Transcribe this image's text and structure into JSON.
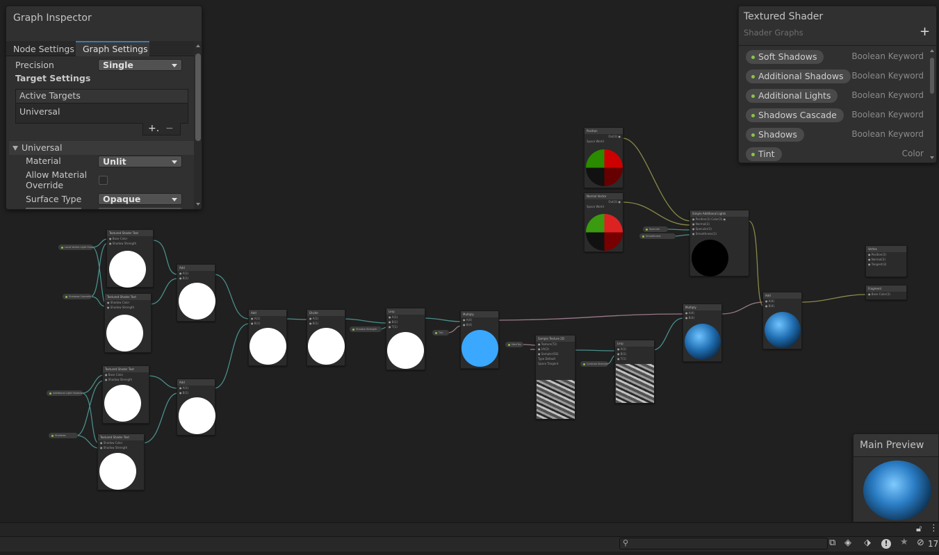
{
  "inspector": {
    "title": "Graph Inspector",
    "tabs": [
      "Node Settings",
      "Graph Settings"
    ],
    "active_tab": "Graph Settings",
    "precision_label": "Precision",
    "precision_value": "Single",
    "target_settings_label": "Target Settings",
    "active_targets_label": "Active Targets",
    "target_item": "Universal",
    "add_symbol": "+.",
    "remove_symbol": "−",
    "section_label": "Universal",
    "material_label": "Material",
    "material_value": "Unlit",
    "allow_override_label": "Allow Material Override",
    "surface_type_label": "Surface Type",
    "surface_type_value": "Opaque"
  },
  "blackboard": {
    "title": "Textured Shader",
    "subtitle": "Shader Graphs",
    "add_symbol": "+",
    "properties": [
      {
        "name": "Soft Shadows",
        "type": "Boolean Keyword"
      },
      {
        "name": "Additional Shadows",
        "type": "Boolean Keyword"
      },
      {
        "name": "Additional Lights",
        "type": "Boolean Keyword"
      },
      {
        "name": "Shadows Cascade",
        "type": "Boolean Keyword"
      },
      {
        "name": "Shadows",
        "type": "Boolean Keyword"
      },
      {
        "name": "Tint",
        "type": "Color"
      }
    ]
  },
  "main_preview": {
    "title": "Main Preview"
  },
  "statusbar": {
    "badge_count": "17",
    "search_placeholder": ""
  },
  "colors": {
    "accent_blue": "#3aa8ff",
    "keyword_dot": "#8bc34a",
    "wire_teal": "#4a8f8a",
    "wire_olive": "#8a8a4a",
    "wire_pink": "#9a7a8a"
  },
  "nodes": [
    {
      "title": "Textured Shader Text",
      "preview": "white"
    },
    {
      "title": "Textured Shader Text",
      "preview": "white"
    },
    {
      "title": "Add",
      "preview": "white"
    },
    {
      "title": "Textured Shader Text",
      "preview": "white"
    },
    {
      "title": "Textured Shader Text",
      "preview": "white"
    },
    {
      "title": "Add",
      "preview": "white"
    },
    {
      "title": "Add",
      "preview": "white"
    },
    {
      "title": "Divide",
      "preview": "white"
    },
    {
      "title": "Lerp",
      "preview": "white"
    },
    {
      "title": "Multiply",
      "preview": "blue"
    },
    {
      "title": "Sample Texture 2D",
      "preview": "texture"
    },
    {
      "title": "Lerp",
      "preview": "texture"
    },
    {
      "title": "Multiply",
      "preview": "sphere-blue"
    },
    {
      "title": "Add",
      "preview": "sphere-blue"
    },
    {
      "title": "Position",
      "preview": "normal-sphere"
    },
    {
      "title": "Normal Vector",
      "preview": "normal-sphere"
    },
    {
      "title": "Simple Additional Lights",
      "preview": "black"
    },
    {
      "title": "Vertex",
      "preview": "none"
    },
    {
      "title": "Fragment",
      "preview": "none"
    }
  ]
}
